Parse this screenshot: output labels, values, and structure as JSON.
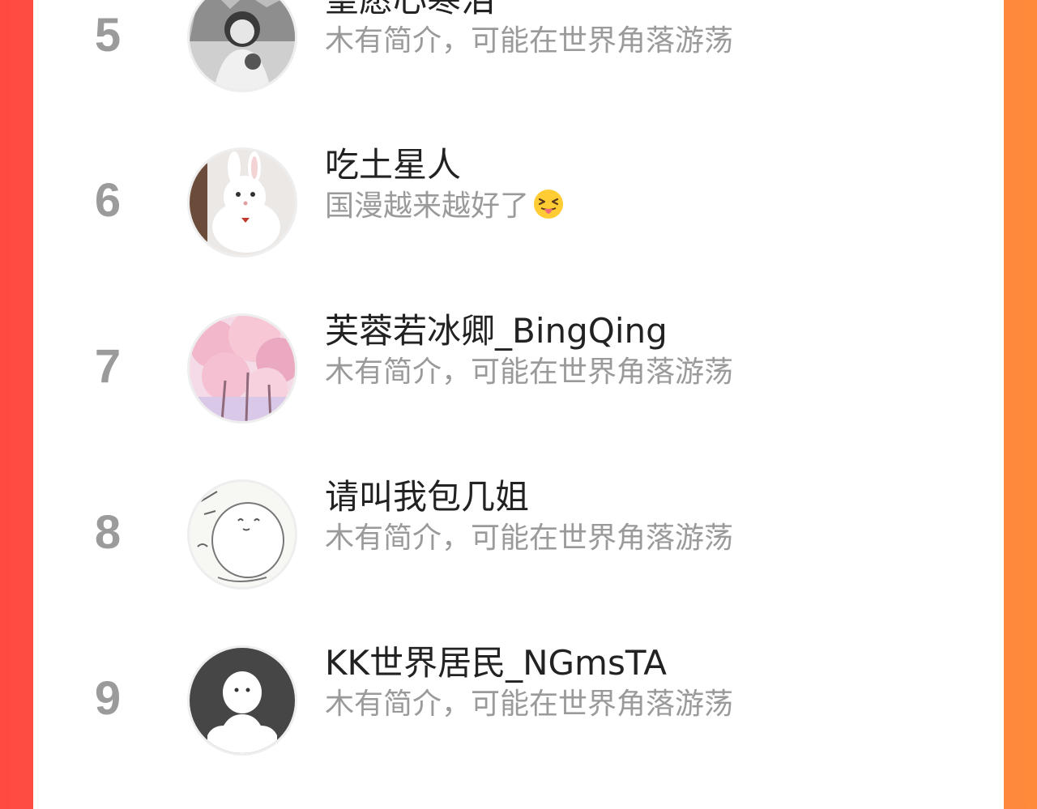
{
  "ranking": {
    "items": [
      {
        "rank": "5",
        "name": "望愿心寒泪",
        "bio": "木有简介，可能在世界角落游荡"
      },
      {
        "rank": "6",
        "name": "吃土星人",
        "bio": "国漫越来越好了"
      },
      {
        "rank": "7",
        "name": "芙蓉若冰卿_BingQing",
        "bio": "木有简介，可能在世界角落游荡"
      },
      {
        "rank": "8",
        "name": "请叫我包几姐",
        "bio": "木有简介，可能在世界角落游荡"
      },
      {
        "rank": "9",
        "name": "KK世界居民_NGmsTA",
        "bio": "木有简介，可能在世界角落游荡"
      }
    ]
  },
  "icons": {
    "bio_emoji_row6": "squinting-tongue-emoji"
  },
  "colors": {
    "background_left": "#ff4a42",
    "background_right": "#ff8a3a",
    "rank_color": "#9b9b9b",
    "name_color": "#222222",
    "bio_color": "#9a9a9a"
  }
}
